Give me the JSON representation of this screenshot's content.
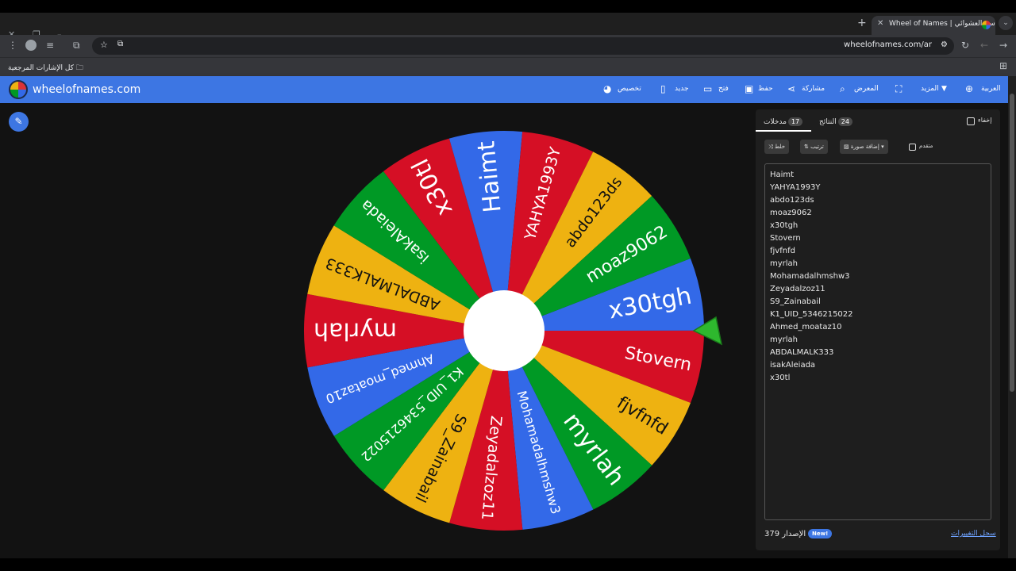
{
  "browser": {
    "tab_title": "Wheel of Names | سم العشوائي",
    "url": "wheelofnames.com/ar",
    "bookmarks_label": "كل الإشارات المرجعية"
  },
  "app": {
    "site_name": "wheelofnames.com",
    "menu": {
      "customize": "تخصيص",
      "new": "جديد",
      "open": "فتح",
      "save": "حفظ",
      "share": "مشاركة",
      "gallery": "المعرض",
      "more": "المزيد",
      "language": "العربية"
    }
  },
  "wheel": {
    "segments": [
      {
        "label": "x30tgh",
        "color": "#3369e8"
      },
      {
        "label": "Stovern",
        "color": "#d50f25"
      },
      {
        "label": "fjvfnfd",
        "color": "#eeb211"
      },
      {
        "label": "myrlah",
        "color": "#009925"
      },
      {
        "label": "Mohamadalhmshw3",
        "color": "#3369e8"
      },
      {
        "label": "Zeyadalzoz11",
        "color": "#d50f25"
      },
      {
        "label": "S9_Zainabail",
        "color": "#eeb211"
      },
      {
        "label": "K1_UID_5346215022",
        "color": "#009925"
      },
      {
        "label": "Ahmed_moataz10",
        "color": "#3369e8"
      },
      {
        "label": "myrlah",
        "color": "#d50f25"
      },
      {
        "label": "ABDALMALK333",
        "color": "#eeb211"
      },
      {
        "label": "isakAleiada",
        "color": "#009925"
      },
      {
        "label": "x30tl",
        "color": "#d50f25"
      },
      {
        "label": "Haimt",
        "color": "#3369e8"
      },
      {
        "label": "YAHYA1993Y",
        "color": "#d50f25"
      },
      {
        "label": "abdo123ds",
        "color": "#eeb211"
      },
      {
        "label": "moaz9062",
        "color": "#009925"
      }
    ]
  },
  "panel": {
    "entries_tab": "مدخلات",
    "entries_count": "17",
    "results_tab": "النتائج",
    "results_count": "24",
    "hide_label": "إخفاء",
    "shuffle_label": "خلط",
    "sort_label": "ترتيب",
    "add_image_label": "إضافة صورة",
    "advanced_label": "متقدم",
    "entries": [
      "Haimt",
      "YAHYA1993Y",
      "abdo123ds",
      "moaz9062",
      "x30tgh",
      "Stovern",
      "fjvfnfd",
      "myrlah",
      "Mohamadalhmshw3",
      "Zeyadalzoz11",
      "S9_Zainabail",
      "K1_UID_5346215022",
      "Ahmed_moataz10",
      "myrlah",
      "ABDALMALK333",
      "isakAleiada",
      "x30tl"
    ],
    "version_label": "379 الإصدار",
    "new_badge": "New!",
    "changelog": "سجل التغييرات"
  }
}
